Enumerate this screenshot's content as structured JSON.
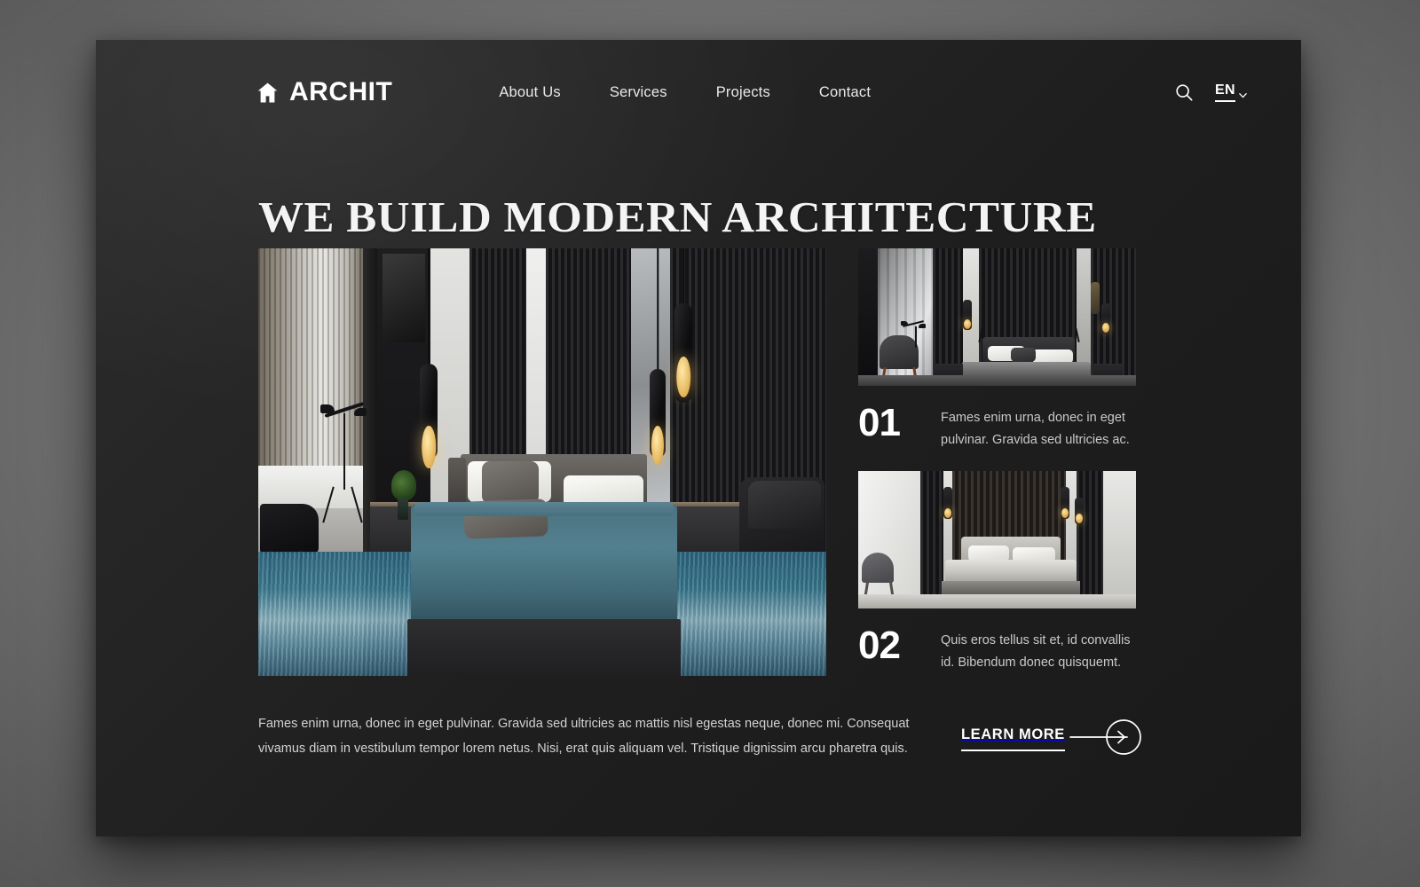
{
  "brand": {
    "name": "ARCHIT",
    "icon": "house-icon"
  },
  "nav": {
    "items": [
      {
        "label": "About Us"
      },
      {
        "label": "Services"
      },
      {
        "label": "Projects"
      },
      {
        "label": "Contact"
      }
    ]
  },
  "header_right": {
    "search_icon": "search-icon",
    "language": "EN",
    "chevron_icon": "chevron-down-icon"
  },
  "hero": {
    "headline": "WE BUILD MODERN ARCHITECTURE",
    "image_alt": "modern-dark-bedroom-interior"
  },
  "cards": [
    {
      "number": "01",
      "description": "Fames enim urna, donec in eget pulvinar. Gravida sed ultricies ac.",
      "image_alt": "dark-slatted-bedroom-with-chair"
    },
    {
      "number": "02",
      "description": "Quis eros tellus sit et, id convallis id. Bibendum donec  quisquemt.",
      "image_alt": "light-bedroom-with-pendant-lamps"
    }
  ],
  "footer": {
    "paragraph": "Fames enim urna, donec in eget pulvinar. Gravida sed ultricies ac mattis nisl egestas neque, donec mi. Consequat vivamus diam in vestibulum tempor lorem netus. Nisi, erat quis aliquam vel. Tristique dignissim arcu pharetra quis.",
    "cta_label": "LEARN MORE",
    "cta_icon": "arrow-right-circle-icon"
  },
  "colors": {
    "page_background": "#1e1e1e",
    "text_primary": "#ffffff",
    "text_secondary": "#c9c9c9",
    "accent_warm": "#e3b256",
    "accent_teal": "#3f6674"
  }
}
